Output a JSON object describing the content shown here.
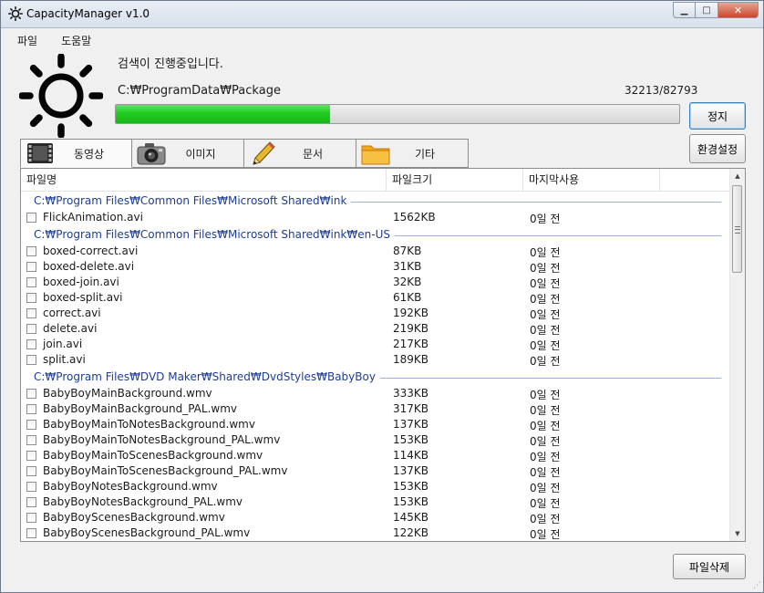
{
  "window": {
    "title": "CapacityManager v1.0"
  },
  "menu": [
    {
      "label": "파일"
    },
    {
      "label": "도움말"
    }
  ],
  "scan": {
    "status": "검색이 진행중입니다.",
    "path": "C:₩ProgramData₩Package",
    "count": "32213/82793",
    "progress": 0.38
  },
  "buttons": {
    "stop": "정지",
    "settings": "환경설정",
    "delete": "파일삭제"
  },
  "tabs": [
    {
      "label": "동영상",
      "icon": "video-icon",
      "active": true
    },
    {
      "label": "이미지",
      "icon": "camera-icon",
      "active": false
    },
    {
      "label": "문서",
      "icon": "pencil-icon",
      "active": false
    },
    {
      "label": "기타",
      "icon": "folder-icon",
      "active": false
    }
  ],
  "columns": [
    {
      "label": "파일명"
    },
    {
      "label": "파일크기"
    },
    {
      "label": "마지막사용"
    }
  ],
  "groups": [
    {
      "path": "C:₩Program Files₩Common Files₩Microsoft Shared₩ink",
      "files": [
        {
          "name": "FlickAnimation.avi",
          "size": "1562KB",
          "last_used": "0일 전"
        }
      ]
    },
    {
      "path": "C:₩Program Files₩Common Files₩Microsoft Shared₩ink₩en-US",
      "files": [
        {
          "name": "boxed-correct.avi",
          "size": "87KB",
          "last_used": "0일 전"
        },
        {
          "name": "boxed-delete.avi",
          "size": "31KB",
          "last_used": "0일 전"
        },
        {
          "name": "boxed-join.avi",
          "size": "32KB",
          "last_used": "0일 전"
        },
        {
          "name": "boxed-split.avi",
          "size": "61KB",
          "last_used": "0일 전"
        },
        {
          "name": "correct.avi",
          "size": "192KB",
          "last_used": "0일 전"
        },
        {
          "name": "delete.avi",
          "size": "219KB",
          "last_used": "0일 전"
        },
        {
          "name": "join.avi",
          "size": "217KB",
          "last_used": "0일 전"
        },
        {
          "name": "split.avi",
          "size": "189KB",
          "last_used": "0일 전"
        }
      ]
    },
    {
      "path": "C:₩Program Files₩DVD Maker₩Shared₩DvdStyles₩BabyBoy",
      "files": [
        {
          "name": "BabyBoyMainBackground.wmv",
          "size": "333KB",
          "last_used": "0일 전"
        },
        {
          "name": "BabyBoyMainBackground_PAL.wmv",
          "size": "317KB",
          "last_used": "0일 전"
        },
        {
          "name": "BabyBoyMainToNotesBackground.wmv",
          "size": "137KB",
          "last_used": "0일 전"
        },
        {
          "name": "BabyBoyMainToNotesBackground_PAL.wmv",
          "size": "153KB",
          "last_used": "0일 전"
        },
        {
          "name": "BabyBoyMainToScenesBackground.wmv",
          "size": "114KB",
          "last_used": "0일 전"
        },
        {
          "name": "BabyBoyMainToScenesBackground_PAL.wmv",
          "size": "137KB",
          "last_used": "0일 전"
        },
        {
          "name": "BabyBoyNotesBackground.wmv",
          "size": "153KB",
          "last_used": "0일 전"
        },
        {
          "name": "BabyBoyNotesBackground_PAL.wmv",
          "size": "153KB",
          "last_used": "0일 전"
        },
        {
          "name": "BabyBoyScenesBackground.wmv",
          "size": "145KB",
          "last_used": "0일 전"
        },
        {
          "name": "BabyBoyScenesBackground_PAL.wmv",
          "size": "122KB",
          "last_used": "0일 전"
        }
      ]
    }
  ]
}
